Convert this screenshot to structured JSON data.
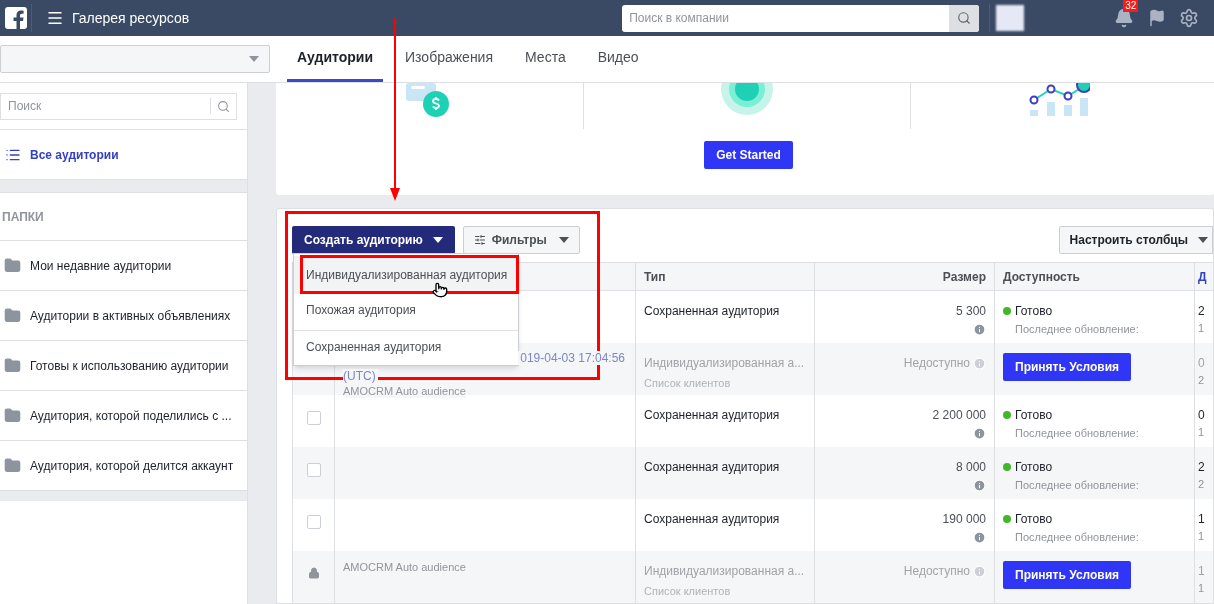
{
  "topbar": {
    "title": "Галерея ресурсов",
    "search": {
      "placeholder": "Поиск в компании"
    },
    "notifications": "32"
  },
  "tabs": [
    {
      "label": "Аудитории",
      "selected": true
    },
    {
      "label": "Изображения",
      "selected": false
    },
    {
      "label": "Места",
      "selected": false
    },
    {
      "label": "Видео",
      "selected": false
    }
  ],
  "sidebar": {
    "search": {
      "placeholder": "Поиск"
    },
    "all": {
      "label": "Все аудитории",
      "selected": true
    },
    "folders_title": "ПАПКИ",
    "folders": [
      {
        "label": "Мои недавние аудитории"
      },
      {
        "label": "Аудитории в активных объявлениях"
      },
      {
        "label": "Готовы к использованию аудитории"
      },
      {
        "label": "Аудитория, которой поделились с ..."
      },
      {
        "label": "Аудитория, которой делится аккаунт"
      }
    ]
  },
  "promo": {
    "button": "Get Started"
  },
  "toolbar": {
    "create": "Создать аудиторию",
    "filters": "Фильтры",
    "columns": "Настроить столбцы"
  },
  "menu": [
    {
      "label": "Индивидуализированная аудитория",
      "highlighted": true,
      "divider_before": false
    },
    {
      "label": "Похожая аудитория",
      "highlighted": false,
      "divider_before": false
    },
    {
      "label": "Сохраненная аудитория",
      "highlighted": false,
      "divider_before": true
    }
  ],
  "table": {
    "columns": [
      "Тип",
      "Размер",
      "Доступность",
      "Д"
    ],
    "rows": [
      {
        "kind": "ready",
        "name_lines": [],
        "type": "Сохраненная аудитория",
        "size": "5 300",
        "status": "Готово",
        "updated": "Последнее обновление:",
        "date": [
          "2",
          "1"
        ]
      },
      {
        "kind": "unavailable",
        "name_lines": [
          {
            "text": "019-04-03 17:04:56",
            "kind": "link_tail"
          },
          {
            "text": "(UTC)",
            "kind": "link"
          },
          {
            "text": "AMOCRM Auto audience",
            "kind": "note"
          }
        ],
        "type": "Индивидуализированная а...",
        "subtype": "Список клиентов",
        "size": "Недоступно",
        "action": "Принять Условия",
        "date": [
          "0",
          "2"
        ]
      },
      {
        "kind": "ready",
        "lead": {
          "kind": "checkbox",
          "checked": false
        },
        "name_lines": [],
        "type": "Сохраненная аудитория",
        "size": "2 200 000",
        "status": "Готово",
        "updated": "Последнее обновление:",
        "date": [
          "0",
          "1"
        ]
      },
      {
        "kind": "ready",
        "lead": {
          "kind": "checkbox",
          "checked": false
        },
        "name_lines": [],
        "type": "Сохраненная аудитория",
        "size": "8 000",
        "status": "Готово",
        "updated": "Последнее обновление:",
        "date": [
          "2",
          "2"
        ]
      },
      {
        "kind": "ready",
        "lead": {
          "kind": "checkbox",
          "checked": false
        },
        "name_lines": [],
        "type": "Сохраненная аудитория",
        "size": "190 000",
        "status": "Готово",
        "updated": "Последнее обновление:",
        "date": [
          "1",
          "1"
        ]
      },
      {
        "kind": "unavailable",
        "lead": {
          "kind": "lock"
        },
        "name_lines": [
          {
            "text": "AMOCRM Auto audience",
            "kind": "note"
          }
        ],
        "type": "Индивидуализированная а...",
        "subtype": "Список клиентов",
        "size": "Недоступно",
        "action": "Принять Условия",
        "date": [
          "1",
          "1"
        ]
      }
    ]
  }
}
